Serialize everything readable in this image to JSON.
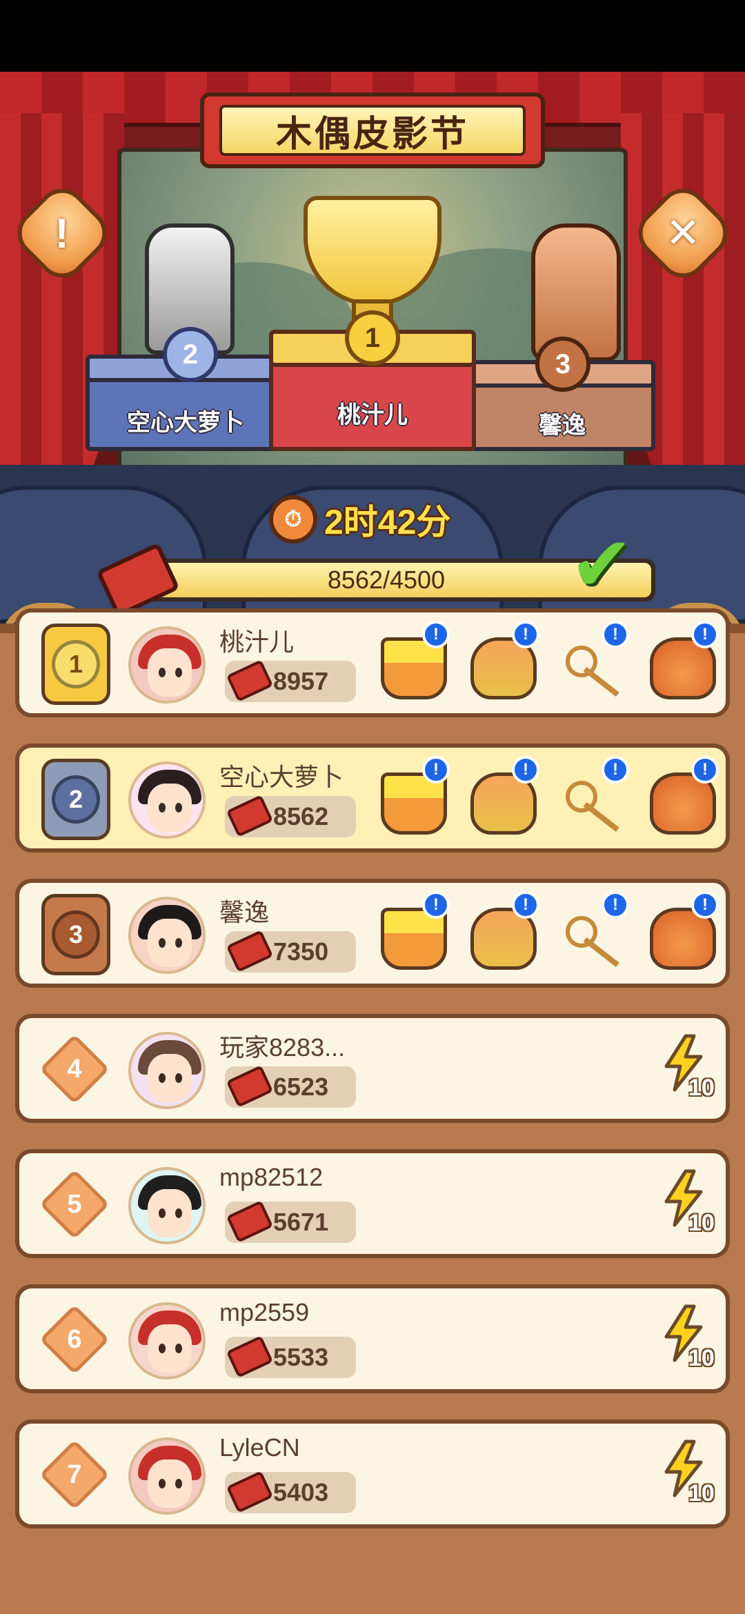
{
  "event": {
    "title": "木偶皮影节",
    "timer": "2时42分",
    "progress_text": "8562/4500",
    "progress_value": 1.0
  },
  "podium": [
    {
      "rank": "2",
      "name": "空心大萝卜"
    },
    {
      "rank": "1",
      "name": "桃汁儿"
    },
    {
      "rank": "3",
      "name": "馨逸"
    }
  ],
  "buttons": {
    "info": "!",
    "close": "✕"
  },
  "rows": [
    {
      "rank": "1",
      "name": "桃汁儿",
      "score": "8957"
    },
    {
      "rank": "2",
      "name": "空心大萝卜",
      "score": "8562"
    },
    {
      "rank": "3",
      "name": "馨逸",
      "score": "7350"
    },
    {
      "rank": "4",
      "name": "玩家8283...",
      "score": "6523",
      "reward_count": "10"
    },
    {
      "rank": "5",
      "name": "mp82512",
      "score": "5671",
      "reward_count": "10"
    },
    {
      "rank": "6",
      "name": "mp2559",
      "score": "5533",
      "reward_count": "10"
    },
    {
      "rank": "7",
      "name": "LyleCN",
      "score": "5403",
      "reward_count": "10"
    }
  ],
  "icons": {
    "alert": "!",
    "reward_types": [
      "energy-bucket-icon",
      "treasure-chest-icon",
      "golden-key-icon",
      "lucky-bag-icon"
    ],
    "energy": "lightning-bolt-icon"
  },
  "colors": {
    "accent": "#f4cf5c",
    "highlight_row": "#fff0b6",
    "alert": "#1e66e8"
  }
}
